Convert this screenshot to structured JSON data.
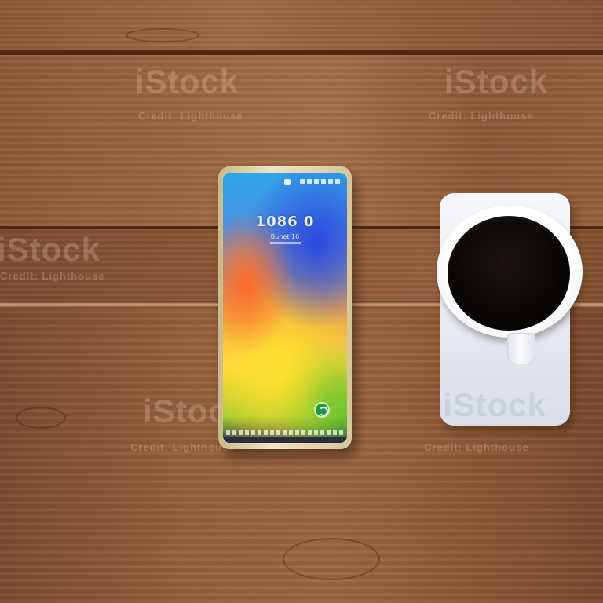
{
  "scene": {
    "description_items": [
      "wooden table",
      "smartphone",
      "cup of black coffee"
    ],
    "colors": {
      "wood": "#9a6440",
      "wood_gap": "#4a2a17",
      "coaster": "#eef0f5",
      "coffee": "#0a0605"
    }
  },
  "phone": {
    "clock": "1086 0",
    "date_line": "Bunet 16",
    "app_icon": "circular-arrow-icon"
  },
  "watermarks": {
    "logo_text": "iStock",
    "credit_text": "Credit: Lighthouse"
  }
}
